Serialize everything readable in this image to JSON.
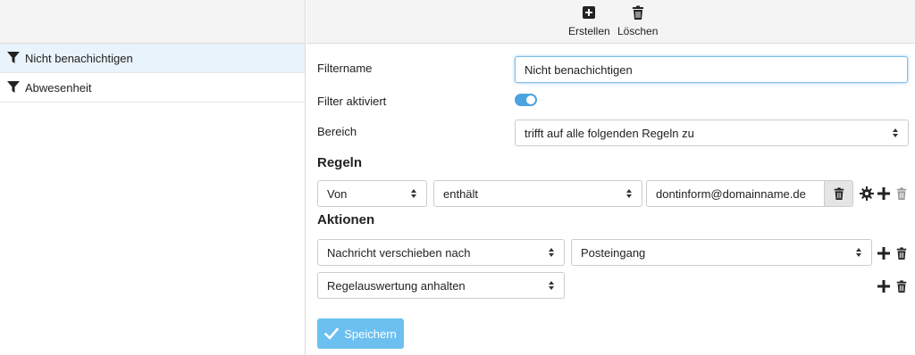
{
  "toolbar": {
    "create_label": "Erstellen",
    "delete_label": "Löschen"
  },
  "filters": [
    {
      "label": "Nicht benachichtigen",
      "selected": true
    },
    {
      "label": "Abwesenheit",
      "selected": false
    }
  ],
  "form": {
    "filtername_label": "Filtername",
    "filtername_value": "Nicht benachichtigen",
    "filter_active_label": "Filter aktiviert",
    "filter_active": true,
    "scope_label": "Bereich",
    "scope_value": "trifft auf alle folgenden Regeln zu"
  },
  "rules": {
    "title": "Regeln",
    "items": [
      {
        "field": "Von",
        "operator": "enthält",
        "value": "dontinform@domainname.de"
      }
    ]
  },
  "actions": {
    "title": "Aktionen",
    "items": [
      {
        "action": "Nachricht verschieben nach",
        "target": "Posteingang"
      },
      {
        "action": "Regelauswertung anhalten"
      }
    ]
  },
  "save_label": "Speichern",
  "colors": {
    "accent": "#4ba3e0",
    "save_bg": "#6cc0f0",
    "selected_bg": "#e9f3fb"
  }
}
